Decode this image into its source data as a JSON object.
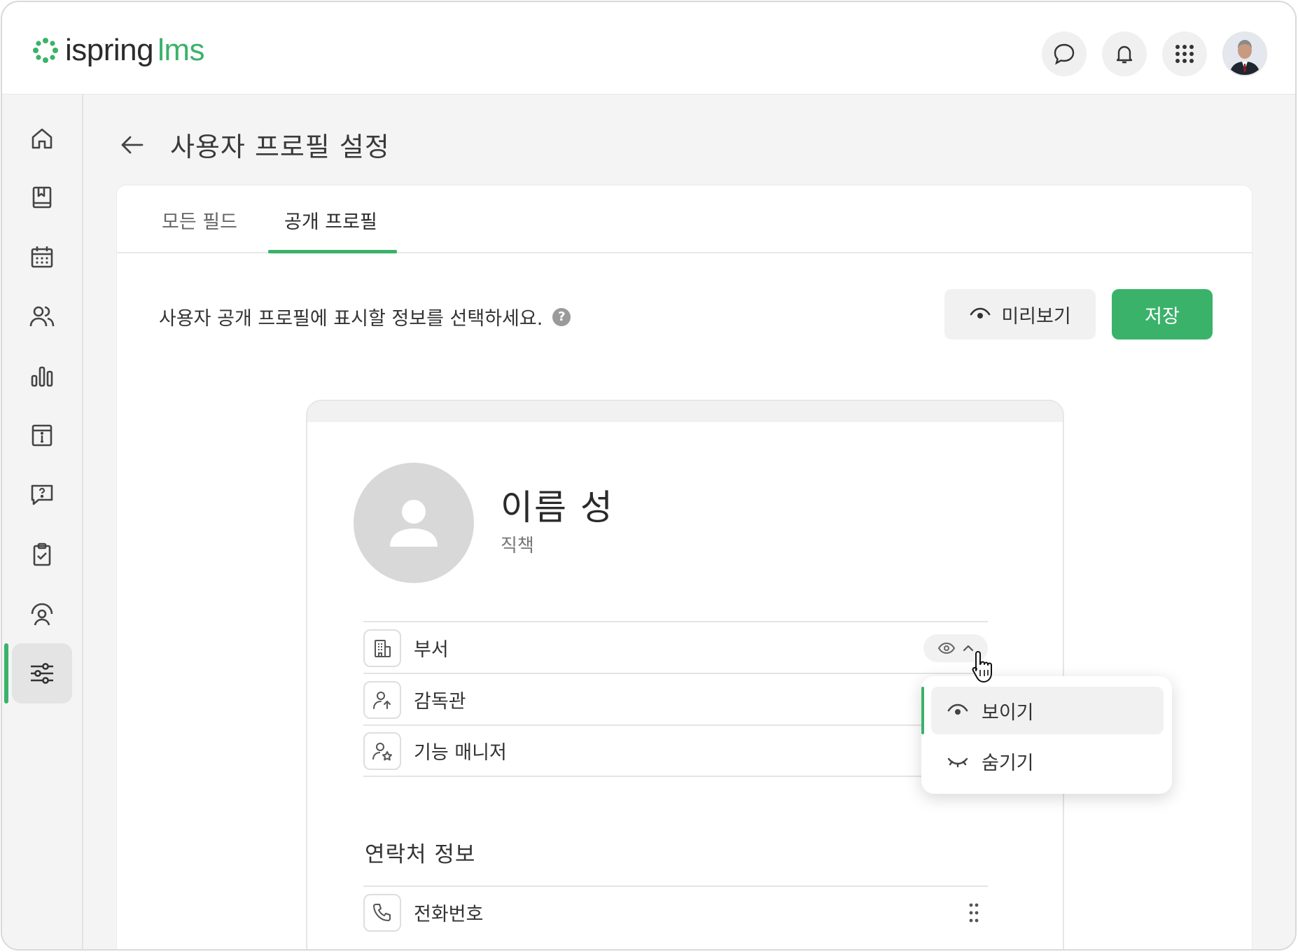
{
  "app": {
    "logo_part1": "ispring",
    "logo_part2": "lms",
    "brand_color": "#3bb26a"
  },
  "topbar": {
    "actions": [
      "chat-icon",
      "bell-icon",
      "apps-grid-icon",
      "user-avatar"
    ]
  },
  "sidebar": {
    "items": [
      {
        "icon": "home-icon"
      },
      {
        "icon": "book-icon"
      },
      {
        "icon": "calendar-icon"
      },
      {
        "icon": "users-icon"
      },
      {
        "icon": "bar-chart-icon"
      },
      {
        "icon": "info-box-icon"
      },
      {
        "icon": "question-chat-icon"
      },
      {
        "icon": "clipboard-check-icon"
      },
      {
        "icon": "user-gauge-icon"
      },
      {
        "icon": "sliders-icon",
        "active": true
      }
    ]
  },
  "page": {
    "title": "사용자 프로필 설정"
  },
  "tabs": [
    {
      "label": "모든 필드",
      "active": false
    },
    {
      "label": "공개 프로필",
      "active": true
    }
  ],
  "content": {
    "instruction": "사용자 공개 프로필에 표시할 정보를 선택하세요.",
    "help_icon": "?",
    "preview_button": "미리보기",
    "save_button": "저장"
  },
  "profile": {
    "name": "이름 성",
    "role": "직책"
  },
  "fields": [
    {
      "label": "부서",
      "icon": "building-icon"
    },
    {
      "label": "감독관",
      "icon": "user-up-icon"
    },
    {
      "label": "기능 매니저",
      "icon": "user-star-icon"
    }
  ],
  "contact_section": {
    "title": "연락처 정보",
    "fields": [
      {
        "label": "전화번호",
        "icon": "phone-icon"
      }
    ]
  },
  "visibility_menu": {
    "options": [
      {
        "label": "보이기",
        "icon": "eye-icon",
        "selected": true
      },
      {
        "label": "숨기기",
        "icon": "eye-closed-icon",
        "selected": false
      }
    ]
  }
}
